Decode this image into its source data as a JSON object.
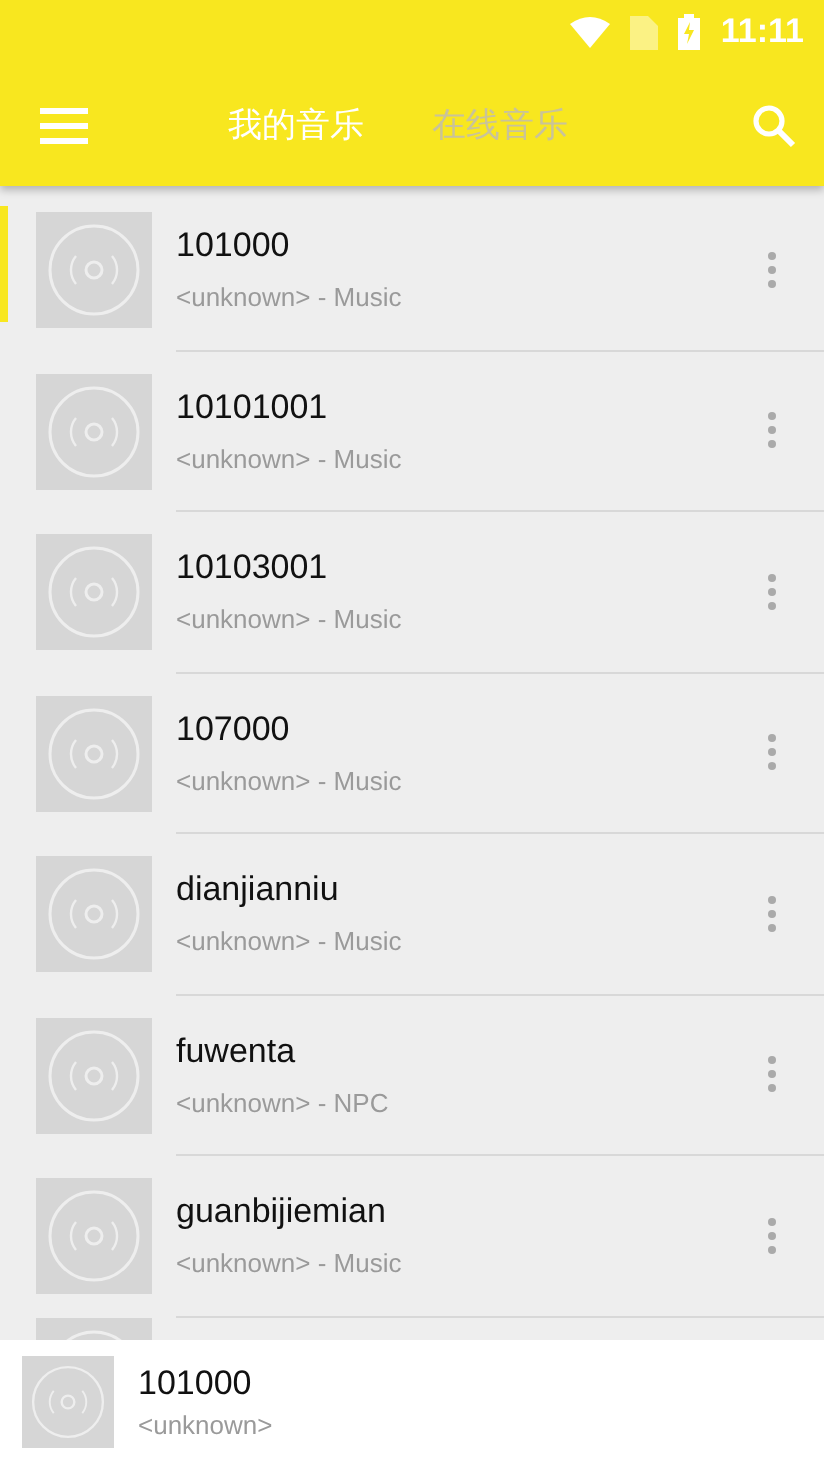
{
  "status_bar": {
    "time": "11:11"
  },
  "app_bar": {
    "tabs": [
      {
        "label": "我的音乐",
        "selected": true
      },
      {
        "label": "在线音乐",
        "selected": false
      }
    ]
  },
  "songs": [
    {
      "title": "101000",
      "subtitle": "<unknown> - Music",
      "selected": true
    },
    {
      "title": "10101001",
      "subtitle": "<unknown> - Music",
      "selected": false
    },
    {
      "title": "10103001",
      "subtitle": "<unknown> - Music",
      "selected": false
    },
    {
      "title": "107000",
      "subtitle": "<unknown> - Music",
      "selected": false
    },
    {
      "title": "dianjianniu",
      "subtitle": "<unknown> - Music",
      "selected": false
    },
    {
      "title": "fuwenta",
      "subtitle": "<unknown> - NPC",
      "selected": false
    },
    {
      "title": "guanbijiemian",
      "subtitle": "<unknown> - Music",
      "selected": false
    }
  ],
  "now_playing": {
    "title": "101000",
    "artist": "<unknown>"
  }
}
